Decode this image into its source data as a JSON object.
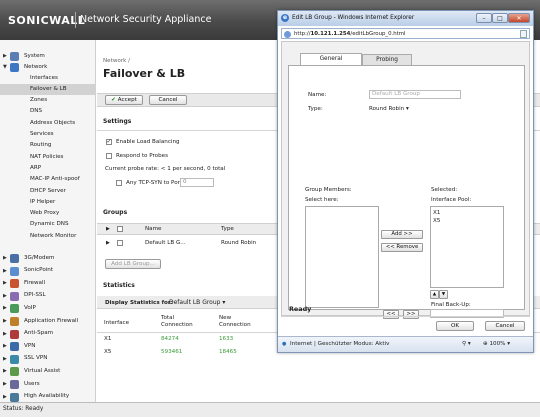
{
  "header": {
    "brand": "SONICWALL",
    "product": "Network Security Appliance"
  },
  "sidebar": {
    "items": [
      {
        "label": "System",
        "expanded": false,
        "icon": "system-icon",
        "color": "#5b7fb5"
      },
      {
        "label": "Network",
        "expanded": true,
        "icon": "network-icon",
        "color": "#3e76c4"
      }
    ],
    "network_sub": [
      "Interfaces",
      "Failover & LB",
      "Zones",
      "DNS",
      "Address Objects",
      "Services",
      "Routing",
      "NAT Policies",
      "ARP",
      "MAC-IP Anti-spoof",
      "DHCP Server",
      "IP Helper",
      "Web Proxy",
      "Dynamic DNS",
      "Network Monitor"
    ],
    "lower_items": [
      {
        "label": "3G/Modem",
        "icon": "modem-icon",
        "color": "#4a6fa5"
      },
      {
        "label": "SonicPoint",
        "icon": "sonicpoint-icon",
        "color": "#5b8ed0"
      },
      {
        "label": "Firewall",
        "icon": "firewall-icon",
        "color": "#c8532f"
      },
      {
        "label": "DPI-SSL",
        "icon": "dpi-ssl-icon",
        "color": "#8a6ab0"
      },
      {
        "label": "VoIP",
        "icon": "voip-icon",
        "color": "#4a9a5a"
      },
      {
        "label": "Application Firewall",
        "icon": "app-firewall-icon",
        "color": "#c0802a"
      },
      {
        "label": "Anti-Spam",
        "icon": "anti-spam-icon",
        "color": "#b03a3a"
      },
      {
        "label": "VPN",
        "icon": "vpn-icon",
        "color": "#3a6aa8"
      },
      {
        "label": "SSL VPN",
        "icon": "ssl-vpn-icon",
        "color": "#3a8aa8"
      },
      {
        "label": "Virtual Assist",
        "icon": "virtual-assist-icon",
        "color": "#5a9a4a"
      },
      {
        "label": "Users",
        "icon": "users-icon",
        "color": "#6a6a9a"
      },
      {
        "label": "High Availability",
        "icon": "ha-icon",
        "color": "#4a7a9a"
      }
    ]
  },
  "main": {
    "breadcrumb": "Network /",
    "title": "Failover & LB",
    "accept_label": "Accept",
    "cancel_label": "Cancel",
    "settings_header": "Settings",
    "enable_lb": "Enable Load Balancing",
    "respond_probes": "Respond to Probes",
    "probe_rate": "Current probe rate: < 1 per second, 0 total",
    "any_tcp_syn": "Any TCP-SYN to Port",
    "port_value": "0",
    "groups_header": "Groups",
    "groups_cols": {
      "name": "Name",
      "type": "Type"
    },
    "group_row": {
      "name": "Default LB G...",
      "type": "Round Robin"
    },
    "add_group_label": "Add LB Group...",
    "statistics_header": "Statistics",
    "display_stats_label": "Display Statistics for:",
    "display_stats_value": "Default LB Group",
    "stats_cols": {
      "interface": "Interface",
      "total": "Total\nConnection",
      "new": "New\nConnection"
    },
    "stats_rows": [
      {
        "interface": "X1",
        "total": "84274",
        "new": "1633"
      },
      {
        "interface": "X5",
        "total": "593461",
        "new": "18465"
      }
    ]
  },
  "popup": {
    "title": "Edit LB Group - Windows Internet Explorer",
    "url_prefix": "http://",
    "url_host": "10.121.1.254",
    "url_path": "/editLbGroup_0.html",
    "tabs": [
      "General",
      "Probing"
    ],
    "name_label": "Name:",
    "name_placeholder": "Default LB Group",
    "type_label": "Type:",
    "type_value": "Round Robin",
    "group_members_label": "Group Members:",
    "select_here_label": "Select here:",
    "selected_label": "Selected:",
    "interface_pool_label": "Interface Pool:",
    "selected_items": [
      "X1",
      "X5"
    ],
    "add_button": "Add >>",
    "remove_button": "<< Remove",
    "final_backup_label": "Final Back-Up:",
    "ready_label": "Ready",
    "ok_label": "OK",
    "cancel_label": "Cancel",
    "ie_status": "Internet | Geschützter Modus: Aktiv",
    "zoom": "100%"
  },
  "status": {
    "text": "Status: Ready"
  }
}
